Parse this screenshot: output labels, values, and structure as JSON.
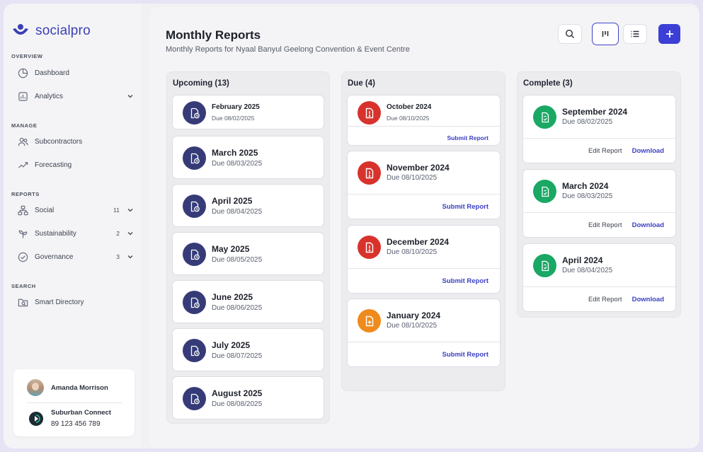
{
  "app": {
    "name": "socialpro"
  },
  "sidebar": {
    "sections": {
      "overview": "OVERVIEW",
      "manage": "MANAGE",
      "reports": "REPORTS",
      "search": "SEARCH"
    },
    "items": {
      "dashboard": {
        "label": "Dashboard",
        "icon": "pie-chart-icon"
      },
      "analytics": {
        "label": "Analytics",
        "icon": "analytics-icon"
      },
      "subcontractors": {
        "label": "Subcontractors",
        "icon": "users-icon"
      },
      "forecasting": {
        "label": "Forecasting",
        "icon": "trend-icon"
      },
      "social": {
        "label": "Social",
        "count": "11",
        "icon": "network-icon"
      },
      "sustainability": {
        "label": "Sustainability",
        "count": "2",
        "icon": "sprout-icon"
      },
      "governance": {
        "label": "Governance",
        "count": "3",
        "icon": "check-circle-icon"
      },
      "smart_directory": {
        "label": "Smart Directory",
        "icon": "folder-search-icon"
      }
    },
    "user": {
      "name": "Amanda Morrison"
    },
    "company": {
      "name": "Suburban Connect",
      "phone": "89 123 456 789"
    }
  },
  "header": {
    "title": "Monthly Reports",
    "subtitle": "Monthly Reports for Nyaal Banyul Geelong Convention & Event Centre"
  },
  "columns": {
    "upcoming": {
      "title": "Upcoming (13)",
      "cards": [
        {
          "title": "February 2025",
          "due": "Due 08/02/2025"
        },
        {
          "title": "March 2025",
          "due": "Due 08/03/2025"
        },
        {
          "title": "April 2025",
          "due": "Due 08/04/2025"
        },
        {
          "title": "May 2025",
          "due": "Due 08/05/2025"
        },
        {
          "title": "June 2025",
          "due": "Due 08/06/2025"
        },
        {
          "title": "July 2025",
          "due": "Due 08/07/2025"
        },
        {
          "title": "August 2025",
          "due": "Due 08/08/2025"
        }
      ]
    },
    "due": {
      "title": "Due (4)",
      "action_label": "Submit Report",
      "cards": [
        {
          "title": "October 2024",
          "due": "Due 08/10/2025",
          "status": "overdue"
        },
        {
          "title": "November 2024",
          "due": "Due 08/10/2025",
          "status": "overdue"
        },
        {
          "title": "December 2024",
          "due": "Due 08/10/2025",
          "status": "overdue"
        },
        {
          "title": "January 2024",
          "due": "Due 08/10/2025",
          "status": "pending"
        }
      ]
    },
    "complete": {
      "title": "Complete (3)",
      "edit_label": "Edit Report",
      "download_label": "Download",
      "cards": [
        {
          "title": "September 2024",
          "due": "Due 08/02/2025"
        },
        {
          "title": "March 2024",
          "due": "Due 08/03/2025"
        },
        {
          "title": "April 2024",
          "due": "Due 08/04/2025"
        }
      ]
    }
  },
  "colors": {
    "accent": "#3b3fd6",
    "upcoming": "#363b78",
    "overdue": "#d8322c",
    "pending": "#ef8a1c",
    "complete": "#1aa864"
  }
}
